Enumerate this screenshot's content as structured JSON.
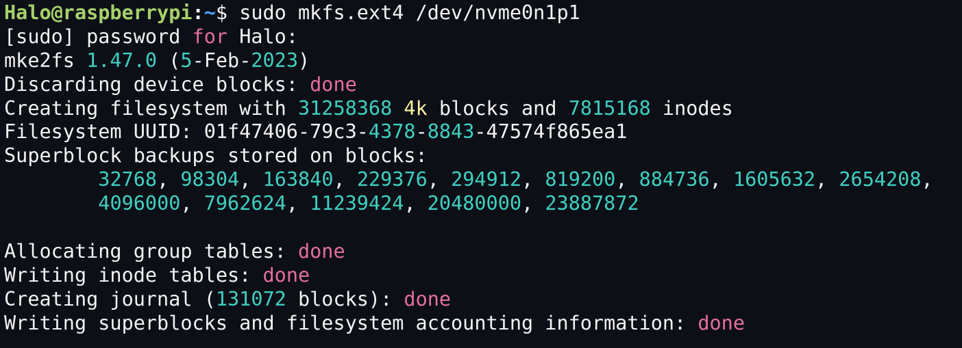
{
  "colors": {
    "background": "#0d0f17",
    "default": "#f3f3f3",
    "user_host": "#a6d16a",
    "path": "#4aa3ff",
    "number": "#3fd0c0",
    "keyword": "#e66ea0",
    "size_unit": "#f5f0a0"
  },
  "terminal": {
    "lines": [
      {
        "segments": [
          {
            "text": "Halo@raspberrypi",
            "color": "user_host",
            "bold": true
          },
          {
            "text": ":",
            "color": "default",
            "bold": true
          },
          {
            "text": "~",
            "color": "path",
            "bold": true
          },
          {
            "text": "$ sudo mkfs.ext4 /dev/nvme0n1p1",
            "color": "default"
          }
        ]
      },
      {
        "segments": [
          {
            "text": "[sudo] password ",
            "color": "default"
          },
          {
            "text": "for",
            "color": "keyword"
          },
          {
            "text": " Halo:",
            "color": "default"
          }
        ]
      },
      {
        "segments": [
          {
            "text": "mke2fs ",
            "color": "default"
          },
          {
            "text": "1.47.0",
            "color": "number"
          },
          {
            "text": " (",
            "color": "default"
          },
          {
            "text": "5",
            "color": "number"
          },
          {
            "text": "-Feb-",
            "color": "default"
          },
          {
            "text": "2023",
            "color": "number"
          },
          {
            "text": ")",
            "color": "default"
          }
        ]
      },
      {
        "segments": [
          {
            "text": "Discarding device blocks: ",
            "color": "default"
          },
          {
            "text": "done",
            "color": "keyword"
          }
        ]
      },
      {
        "segments": [
          {
            "text": "Creating filesystem with ",
            "color": "default"
          },
          {
            "text": "31258368",
            "color": "number"
          },
          {
            "text": " ",
            "color": "default"
          },
          {
            "text": "4k",
            "color": "size_unit"
          },
          {
            "text": " blocks and ",
            "color": "default"
          },
          {
            "text": "7815168",
            "color": "number"
          },
          {
            "text": " inodes",
            "color": "default"
          }
        ]
      },
      {
        "segments": [
          {
            "text": "Filesystem UUID: 01f47406-79c3-",
            "color": "default"
          },
          {
            "text": "4378",
            "color": "number"
          },
          {
            "text": "-",
            "color": "default"
          },
          {
            "text": "8843",
            "color": "number"
          },
          {
            "text": "-47574f865ea1",
            "color": "default"
          }
        ]
      },
      {
        "segments": [
          {
            "text": "Superblock backups stored on blocks:",
            "color": "default"
          }
        ]
      },
      {
        "segments": [
          {
            "text": "        ",
            "color": "default"
          },
          {
            "text": "32768",
            "color": "number"
          },
          {
            "text": ", ",
            "color": "default"
          },
          {
            "text": "98304",
            "color": "number"
          },
          {
            "text": ", ",
            "color": "default"
          },
          {
            "text": "163840",
            "color": "number"
          },
          {
            "text": ", ",
            "color": "default"
          },
          {
            "text": "229376",
            "color": "number"
          },
          {
            "text": ", ",
            "color": "default"
          },
          {
            "text": "294912",
            "color": "number"
          },
          {
            "text": ", ",
            "color": "default"
          },
          {
            "text": "819200",
            "color": "number"
          },
          {
            "text": ", ",
            "color": "default"
          },
          {
            "text": "884736",
            "color": "number"
          },
          {
            "text": ", ",
            "color": "default"
          },
          {
            "text": "1605632",
            "color": "number"
          },
          {
            "text": ", ",
            "color": "default"
          },
          {
            "text": "2654208",
            "color": "number"
          },
          {
            "text": ",",
            "color": "default"
          }
        ]
      },
      {
        "segments": [
          {
            "text": "        ",
            "color": "default"
          },
          {
            "text": "4096000",
            "color": "number"
          },
          {
            "text": ", ",
            "color": "default"
          },
          {
            "text": "7962624",
            "color": "number"
          },
          {
            "text": ", ",
            "color": "default"
          },
          {
            "text": "11239424",
            "color": "number"
          },
          {
            "text": ", ",
            "color": "default"
          },
          {
            "text": "20480000",
            "color": "number"
          },
          {
            "text": ", ",
            "color": "default"
          },
          {
            "text": "23887872",
            "color": "number"
          }
        ]
      },
      {
        "segments": []
      },
      {
        "segments": [
          {
            "text": "Allocating group tables: ",
            "color": "default"
          },
          {
            "text": "done",
            "color": "keyword"
          }
        ]
      },
      {
        "segments": [
          {
            "text": "Writing inode tables: ",
            "color": "default"
          },
          {
            "text": "done",
            "color": "keyword"
          }
        ]
      },
      {
        "segments": [
          {
            "text": "Creating journal (",
            "color": "default"
          },
          {
            "text": "131072",
            "color": "number"
          },
          {
            "text": " blocks): ",
            "color": "default"
          },
          {
            "text": "done",
            "color": "keyword"
          }
        ]
      },
      {
        "segments": [
          {
            "text": "Writing superblocks and filesystem accounting information: ",
            "color": "default"
          },
          {
            "text": "done",
            "color": "keyword"
          }
        ]
      }
    ]
  }
}
